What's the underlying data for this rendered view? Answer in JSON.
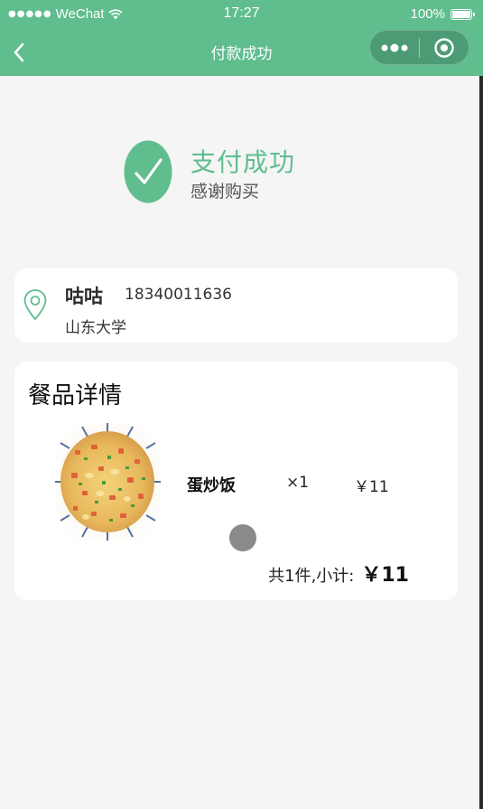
{
  "status_bar": {
    "signal_dots": "●●●●●",
    "carrier": "WeChat",
    "time": "17:27",
    "battery": "100%"
  },
  "nav": {
    "title": "付款成功",
    "back_icon": "chevron-left-icon",
    "more_icon": "more-dots-icon",
    "close_icon": "target-icon"
  },
  "success": {
    "title": "支付成功",
    "subtitle": "感谢购买"
  },
  "address": {
    "name": "咕咕",
    "phone": "18340011636",
    "location": "山东大学"
  },
  "order": {
    "section_title": "餐品详情",
    "items": [
      {
        "name": "蛋炒饭",
        "qty": "×1",
        "price": "￥11"
      }
    ],
    "total_label": "共1件,小计:",
    "total_amount": "￥11"
  },
  "colors": {
    "brand": "#5fbd8e",
    "background": "#f5f5f5"
  }
}
